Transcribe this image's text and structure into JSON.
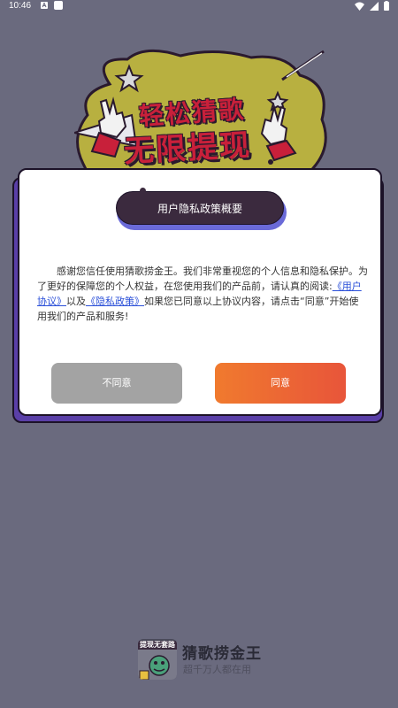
{
  "status_bar": {
    "time": "10:46",
    "left_icons": [
      "a-icon",
      "square-icon"
    ],
    "right_icons": [
      "wifi-icon",
      "signal-icon",
      "battery-icon"
    ]
  },
  "banner": {
    "line1": "轻松猜歌",
    "line2": "无限提现"
  },
  "dialog": {
    "title": "用户隐私政策概要",
    "body_prefix": "感谢您信任使用猜歌捞金王。我们非常重视您的个人信息和隐私保护。为了更好的保障您的个人权益，在您使用我们的产品前，请认真的阅读:",
    "user_agreement_link": "《用户协议》",
    "and_text": "以及",
    "privacy_policy_link": "《隐私政策》",
    "body_suffix": "如果您已同意以上协议内容，请点击“同意”开始使用我们的产品和服务!",
    "disagree_label": "不同意",
    "agree_label": "同意"
  },
  "footer": {
    "logo_text": "提现无套路",
    "app_name": "猜歌捞金王",
    "tagline": "超千万人都在用"
  },
  "colors": {
    "background": "#6a6a7e",
    "dialog_bg": "#ffffff",
    "title_pill": "#3b2a3e",
    "link": "#2a4fd8",
    "disagree": "#a3a3a3",
    "agree_start": "#f07a2e",
    "agree_end": "#e8553a"
  }
}
